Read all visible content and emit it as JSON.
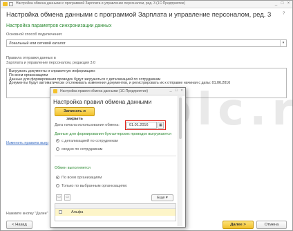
{
  "window": {
    "title": "Настройка обмена данными с программой Зарплата и управление персоналом, ред. 3 (1С:Предприятие)",
    "minimize": "_",
    "maximize": "□",
    "close": "×"
  },
  "main": {
    "heading": "Настройка обмена данными с программой Зарплата и управление персоналом, ред. 3",
    "subheading": "Настройка параметров синхронизации данных",
    "connection_label": "Основной способ подключения:",
    "connection_value": "Локальный или сетевой каталог",
    "rules_label_1": "Правила отправки данных в",
    "rules_label_2": "Зарплата и управление персоналом, редакция 3.0",
    "rules_lines": [
      "Выгружать документы и справочную информацию:",
      "По всем организациям",
      "Данные для формирования проводок будут загружаться с детализацией по сотрудникам",
      "Документы будут автоматически отслеживать изменения документов, и регистрировать их к отправке начиная с даты: 01.06.2016"
    ],
    "change_rules_link": "Изменить правила выгр",
    "bottom_hint": "Нажмите кнопку \"Далее\"",
    "back_button": "< Назад",
    "next_button": "Далее >",
    "cancel_button": "Отмена",
    "help": "?"
  },
  "dialog": {
    "title": "Настройка правил обмена данными (1С:Предприятие)",
    "heading": "Настройка правил обмена данными",
    "save_close_button": "Записать и закрыть",
    "date_label": "Дата начала использования обмена:",
    "date_value": "01.01.2016",
    "calendar_icon": "▦",
    "data_section_title": "Данные для формирования бухгалтерских проводок выгружаются",
    "radio_detail": "с детализацией по сотрудникам",
    "radio_summary": "сводно по сотрудникам",
    "exchange_section_title": "Обмен выполняется",
    "radio_all_orgs": "По всем организациям",
    "radio_selected_orgs": "Только по выбранным организациям:",
    "more_button": "Еще",
    "org_rows": [
      "Альфа"
    ],
    "minimize": "_",
    "maximize": "□",
    "close": "×"
  },
  "watermark": "zolc.ru"
}
